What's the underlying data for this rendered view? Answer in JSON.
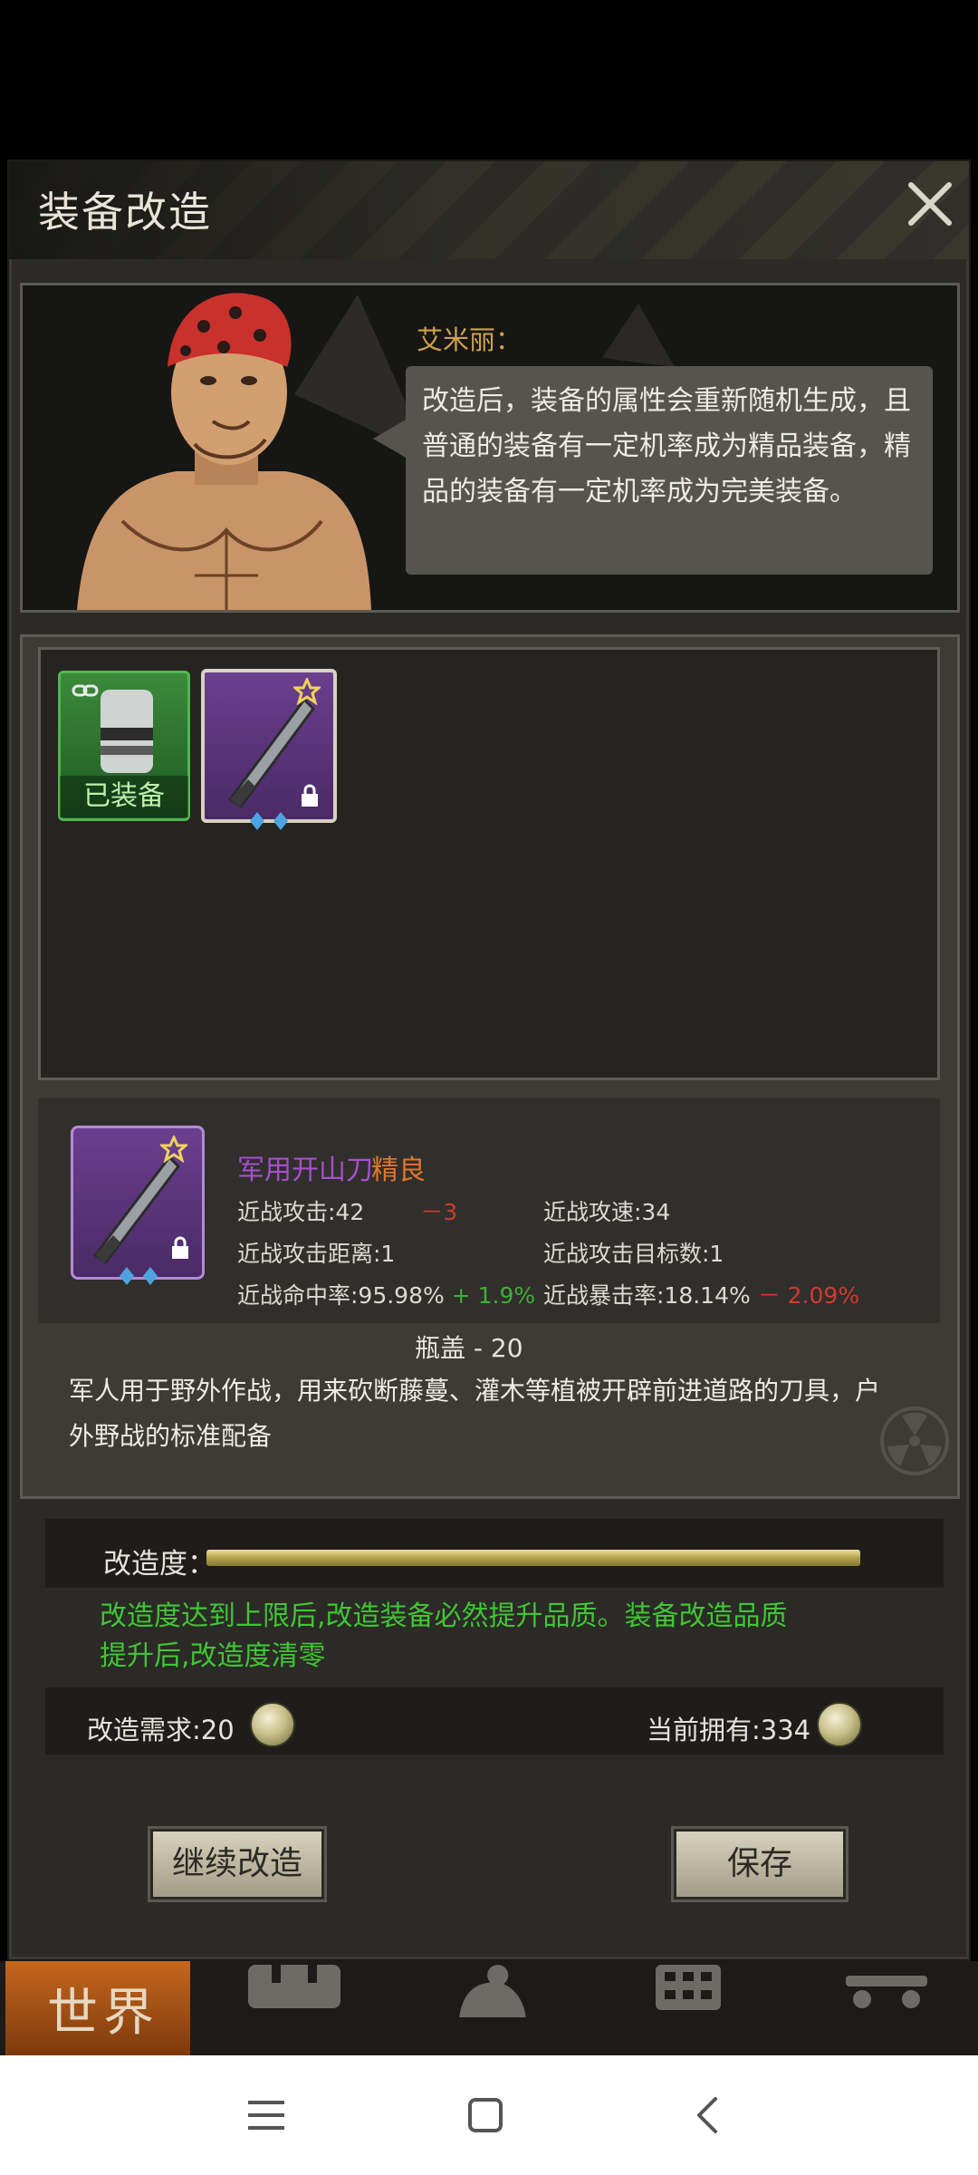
{
  "window": {
    "title": "装备改造"
  },
  "npc": {
    "name": "艾米丽：",
    "dialogue": "改造后，装备的属性会重新随机生成，且普通的装备有一定机率成为精品装备，精品的装备有一定机率成为完美装备。"
  },
  "inventory": {
    "equipped_label": "已装备"
  },
  "item": {
    "name": "军用开山刀",
    "quality": "精良",
    "stats": [
      {
        "label": "近战攻击:42",
        "delta": "－3",
        "delta_color": "#d13a2e"
      },
      {
        "label": "近战攻速:34",
        "delta": "",
        "delta_color": ""
      },
      {
        "label": "近战攻击距离:1",
        "delta": "",
        "delta_color": ""
      },
      {
        "label": "近战攻击目标数:1",
        "delta": "",
        "delta_color": ""
      },
      {
        "label": "近战命中率:95.98%",
        "delta": "+ 1.9%",
        "delta_color": "#3fae3a"
      },
      {
        "label": "近战暴击率:18.14%",
        "delta": "－ 2.09%",
        "delta_color": "#d13a2e"
      }
    ],
    "cost": "瓶盖 - 20",
    "description": "军人用于野外作战，用来砍断藤蔓、灌木等植被开辟前进道路的刀具，户外野战的标准配备"
  },
  "modify": {
    "progress_label": "改造度：",
    "progress_fraction": 1.0,
    "note": "改造度达到上限后,改造装备必然提升品质。装备改造品质提升后,改造度清零",
    "requirement": "改造需求:20",
    "owned": "当前拥有:334"
  },
  "buttons": {
    "continue": "继续改造",
    "save": "保存"
  },
  "bottom_nav": {
    "world": "世界"
  },
  "colors": {
    "quality_purple": "#a64fd0",
    "quality_orange": "#e0762a",
    "note_green": "#41c536",
    "npc_name_gold": "#cda24a"
  }
}
